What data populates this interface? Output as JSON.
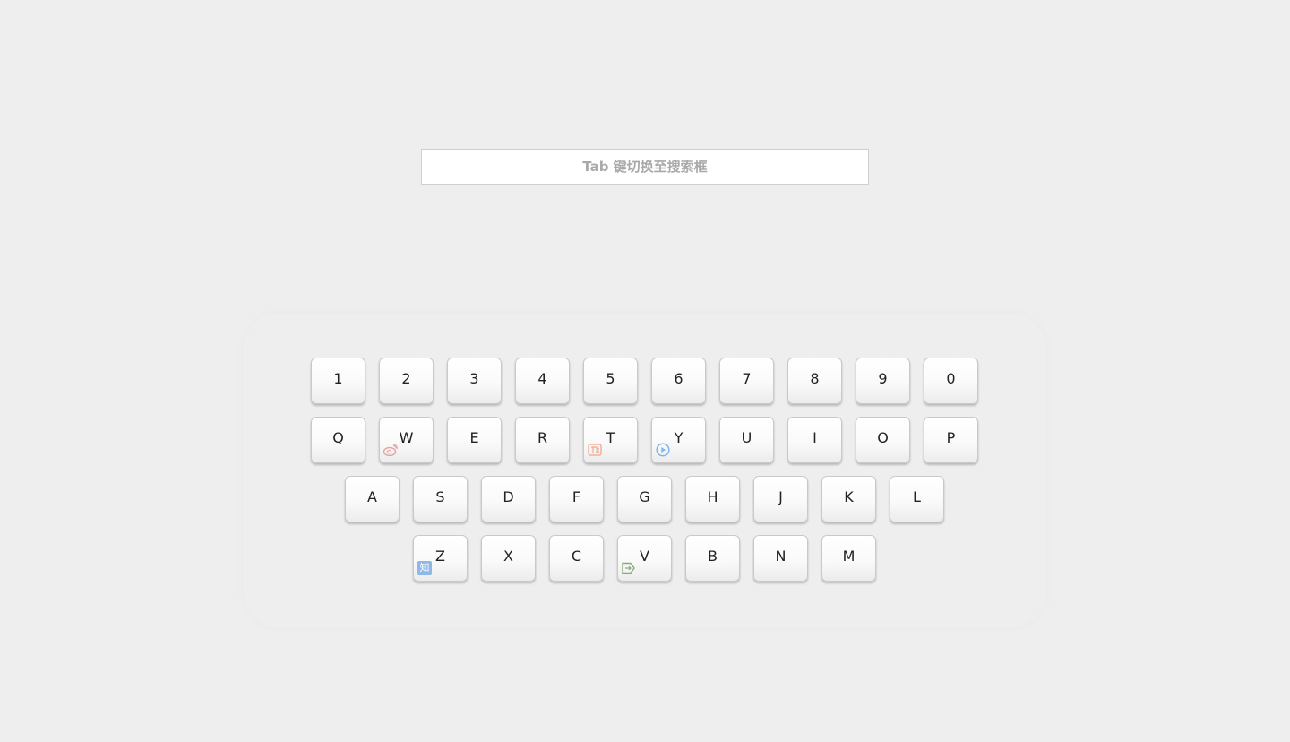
{
  "search": {
    "placeholder": "Tab 键切换至搜索框"
  },
  "keyboard": {
    "rows": [
      {
        "name": "digits",
        "keys": [
          {
            "label": "1"
          },
          {
            "label": "2"
          },
          {
            "label": "3"
          },
          {
            "label": "4"
          },
          {
            "label": "5"
          },
          {
            "label": "6"
          },
          {
            "label": "7"
          },
          {
            "label": "8"
          },
          {
            "label": "9"
          },
          {
            "label": "0"
          }
        ]
      },
      {
        "name": "q-row",
        "keys": [
          {
            "label": "Q"
          },
          {
            "label": "W",
            "icon": "weibo-icon",
            "icon_color": "#e8a0a0"
          },
          {
            "label": "E"
          },
          {
            "label": "R"
          },
          {
            "label": "T",
            "icon": "taobao-icon",
            "icon_color": "#f4a58a"
          },
          {
            "label": "Y",
            "icon": "youku-icon",
            "icon_color": "#7fb8e8"
          },
          {
            "label": "U"
          },
          {
            "label": "I"
          },
          {
            "label": "O"
          },
          {
            "label": "P"
          }
        ]
      },
      {
        "name": "a-row",
        "keys": [
          {
            "label": "A"
          },
          {
            "label": "S"
          },
          {
            "label": "D"
          },
          {
            "label": "F"
          },
          {
            "label": "G"
          },
          {
            "label": "H"
          },
          {
            "label": "J"
          },
          {
            "label": "K"
          },
          {
            "label": "L"
          }
        ]
      },
      {
        "name": "z-row",
        "keys": [
          {
            "label": "Z",
            "icon": "zhihu-icon",
            "icon_color": "#8fb8e6",
            "icon_text": "知"
          },
          {
            "label": "X"
          },
          {
            "label": "C"
          },
          {
            "label": "V",
            "icon": "v2ex-icon",
            "icon_color": "#8aaa78"
          },
          {
            "label": "B"
          },
          {
            "label": "N"
          },
          {
            "label": "M"
          }
        ]
      }
    ]
  }
}
